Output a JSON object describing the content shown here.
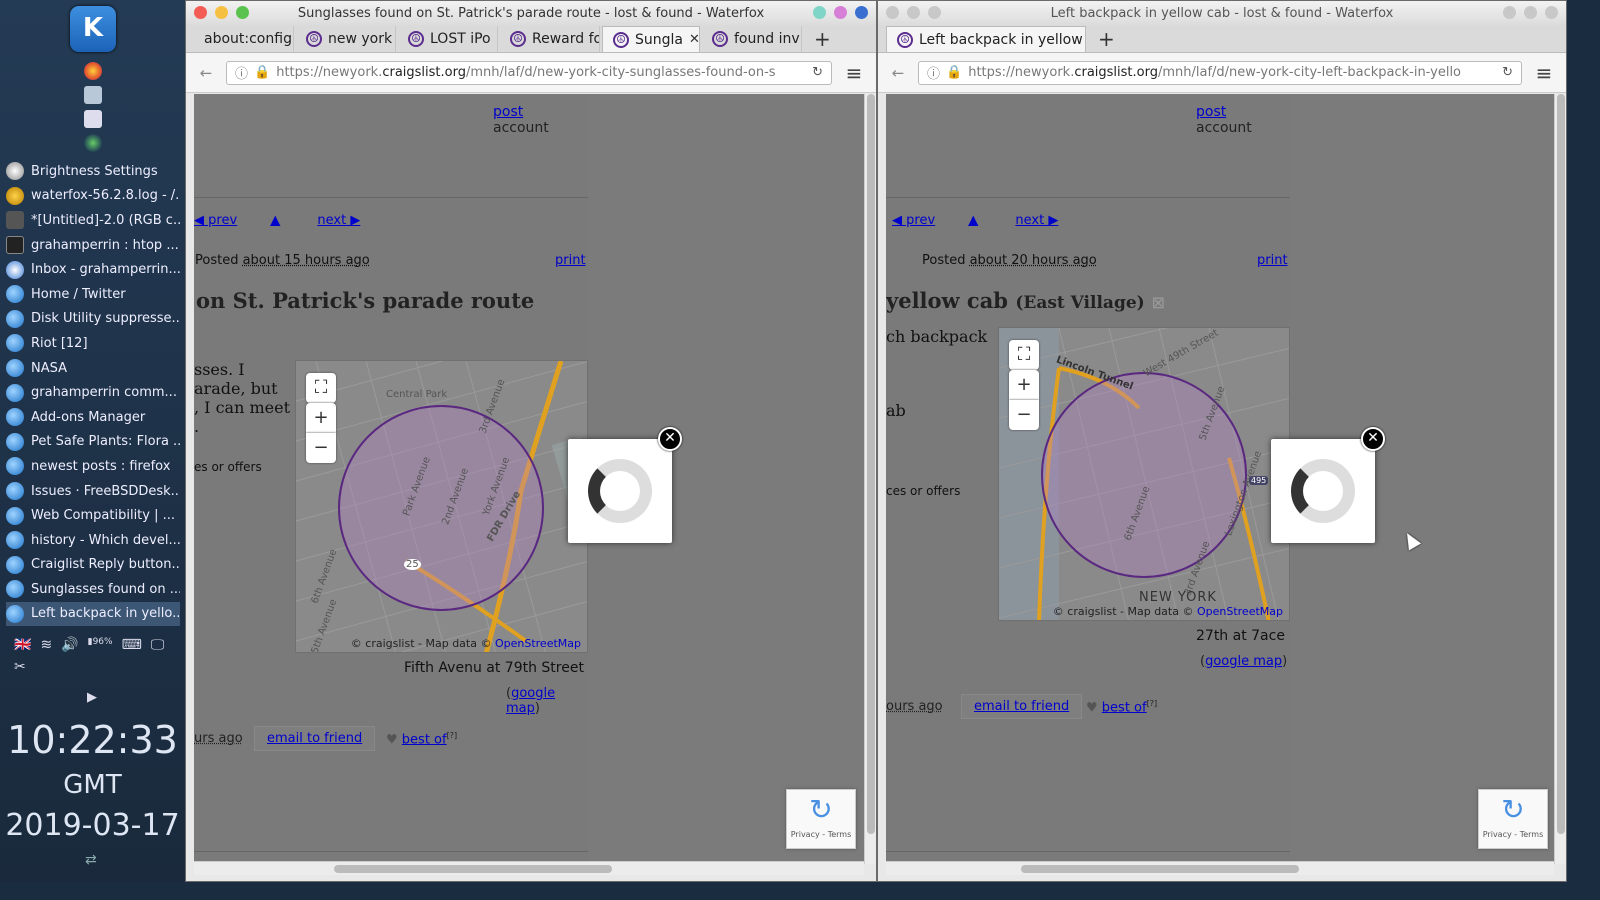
{
  "panel": {
    "tasks": [
      "Brightness Settings",
      "waterfox-56.2.8.log - /...",
      "*[Untitled]-2.0 (RGB c...",
      "grahamperrin : htop ...",
      "Inbox - grahamperrin...",
      "Home / Twitter",
      "Disk Utility suppresse...",
      "Riot [12]",
      "NASA",
      "grahamperrin comm...",
      "Add-ons Manager",
      "Pet Safe Plants: Flora ...",
      "newest posts : firefox",
      "Issues · FreeBSDDesk...",
      "Web Compatibility | ...",
      "history - Which devel...",
      "Craiglist Reply button...",
      "Sunglasses found on ...",
      "Left backpack in yello..."
    ],
    "battery": "96%",
    "clock_time": "10:22:33",
    "clock_zone": "GMT",
    "clock_date": "2019-03-17"
  },
  "win1": {
    "title": "Sunglasses found on St. Patrick's parade route - lost & found - Waterfox",
    "tabs": [
      "about:config",
      "new york",
      "LOST iPo",
      "Reward fo",
      "Sungla",
      "found inv"
    ],
    "url_pre": "https://newyork.",
    "url_host": "craigslist.org",
    "url_post": "/mnh/laf/d/new-york-city-sunglasses-found-on-s",
    "post": "post",
    "account": "account",
    "prev": "◀ prev",
    "up": "▲",
    "next": "next ▶",
    "posted_label": "Posted",
    "posted_time": "about 15 hours ago",
    "print": "print",
    "title_text": "on St. Patrick's parade route",
    "body_lines": [
      "sses. I",
      "arade, but",
      ", I can meet",
      "."
    ],
    "offers": "es or offers",
    "map_credit_pre": "© craigslist - Map data ©",
    "map_credit_osm": "OpenStreetMap",
    "streets": [
      "Central Park",
      "3rd Avenue",
      "Park Avenue",
      "2nd Avenue",
      "York Avenue",
      "FDR Drive",
      "6th Avenue",
      "5th Avenue",
      "25"
    ],
    "address": "Fifth Avenu at 79th Street",
    "google_map": "google map",
    "ago": "urs ago",
    "email": "email to friend",
    "bestof": "best of"
  },
  "win2": {
    "title": "Left backpack in yellow cab - lost & found - Waterfox",
    "tabs": [
      "Left backpack in yellow"
    ],
    "url_pre": "https://newyork.",
    "url_host": "craigslist.org",
    "url_post": "/mnh/laf/d/new-york-city-left-backpack-in-yello",
    "post": "post",
    "account": "account",
    "prev": "◀ prev",
    "up": "▲",
    "next": "next ▶",
    "posted_label": "Posted",
    "posted_time": "about 20 hours ago",
    "print": "print",
    "title_text": "yellow cab",
    "title_small": "(East Village)",
    "body_lines": [
      "ch backpack",
      "",
      "",
      "ab"
    ],
    "offers": "ces or offers",
    "map_credit_pre": "© craigslist - Map data ©",
    "map_credit_osm": "OpenStreetMap",
    "streets": [
      "West 49th Street",
      "Lincoln Tunnel",
      "5th Avenue",
      "Lexington Avenue",
      "6th Avenue",
      "3rd Avenue",
      "NEW YORK",
      "495"
    ],
    "address": "27th at 7ace",
    "google_map": "google map",
    "ago": "ours ago",
    "email": "email to friend",
    "bestof": "best of"
  },
  "recaptcha": "Privacy - Terms"
}
